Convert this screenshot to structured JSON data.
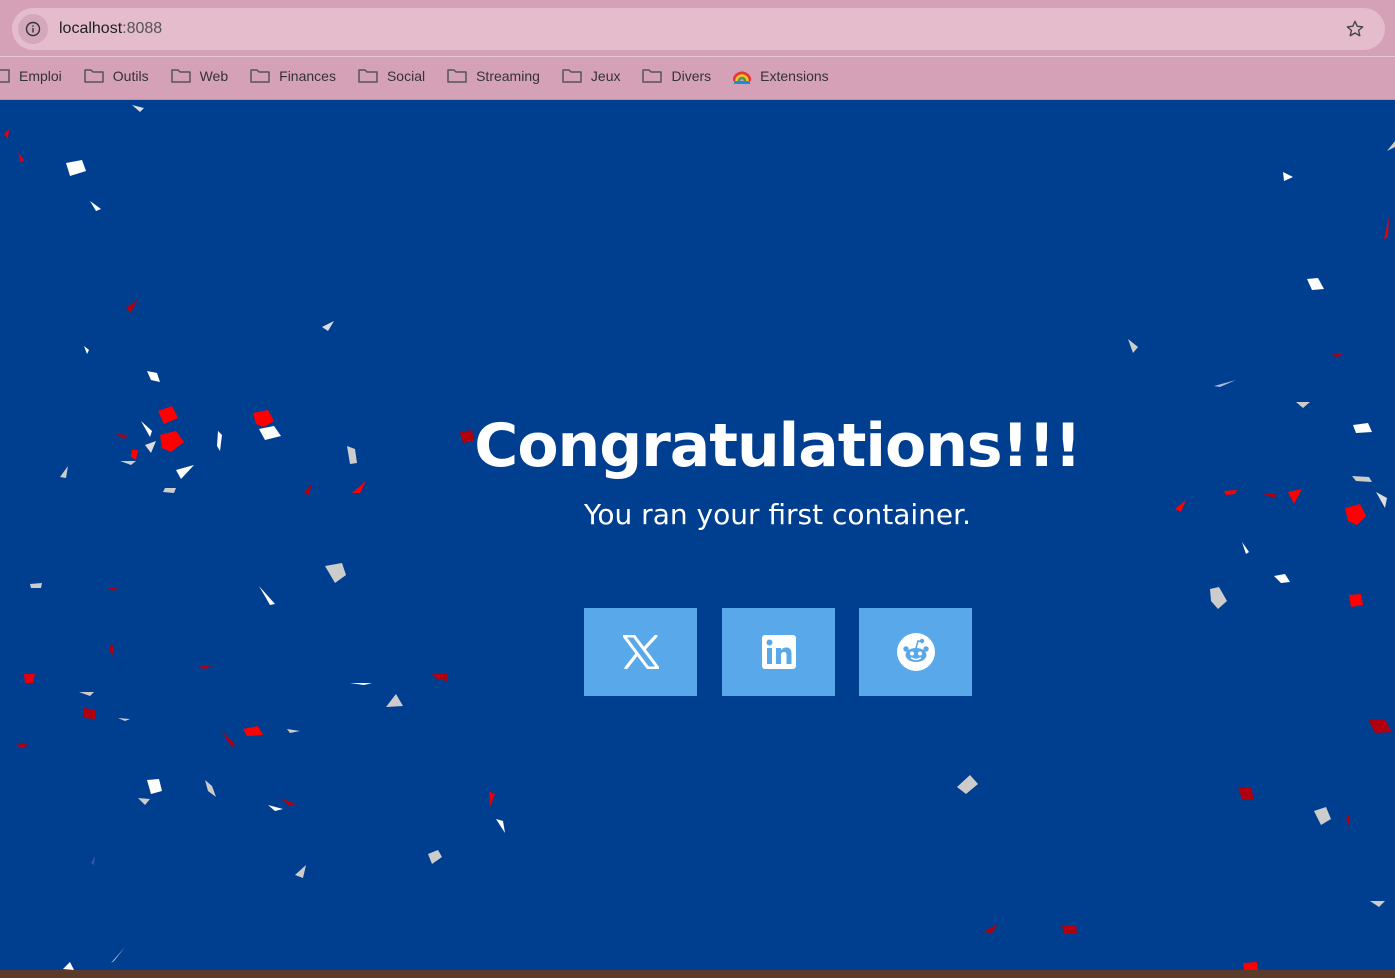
{
  "browser": {
    "url_host": "localhost",
    "url_port": ":8088",
    "icons": {
      "site_info": "info-icon",
      "bookmark": "star-icon"
    }
  },
  "bookmarks": [
    {
      "label": "Emploi",
      "icon": "folder-icon"
    },
    {
      "label": "Outils",
      "icon": "folder-icon"
    },
    {
      "label": "Web",
      "icon": "folder-icon"
    },
    {
      "label": "Finances",
      "icon": "folder-icon"
    },
    {
      "label": "Social",
      "icon": "folder-icon"
    },
    {
      "label": "Streaming",
      "icon": "folder-icon"
    },
    {
      "label": "Jeux",
      "icon": "folder-icon"
    },
    {
      "label": "Divers",
      "icon": "folder-icon"
    },
    {
      "label": "Extensions",
      "icon": "extensions-icon"
    }
  ],
  "page": {
    "headline": "Congratulations!!!",
    "subheadline": "You ran your first container.",
    "share_buttons": [
      {
        "network": "x",
        "icon": "x-logo-icon"
      },
      {
        "network": "linkedin",
        "icon": "linkedin-logo-icon"
      },
      {
        "network": "reddit",
        "icon": "reddit-logo-icon"
      }
    ]
  },
  "colors": {
    "background": "#003f8f",
    "toolbar": "#d5a1b6",
    "share_button": "#58a8ea",
    "confetti": [
      "#ffffff",
      "#cccccc",
      "#ff0000",
      "#b00010"
    ]
  }
}
